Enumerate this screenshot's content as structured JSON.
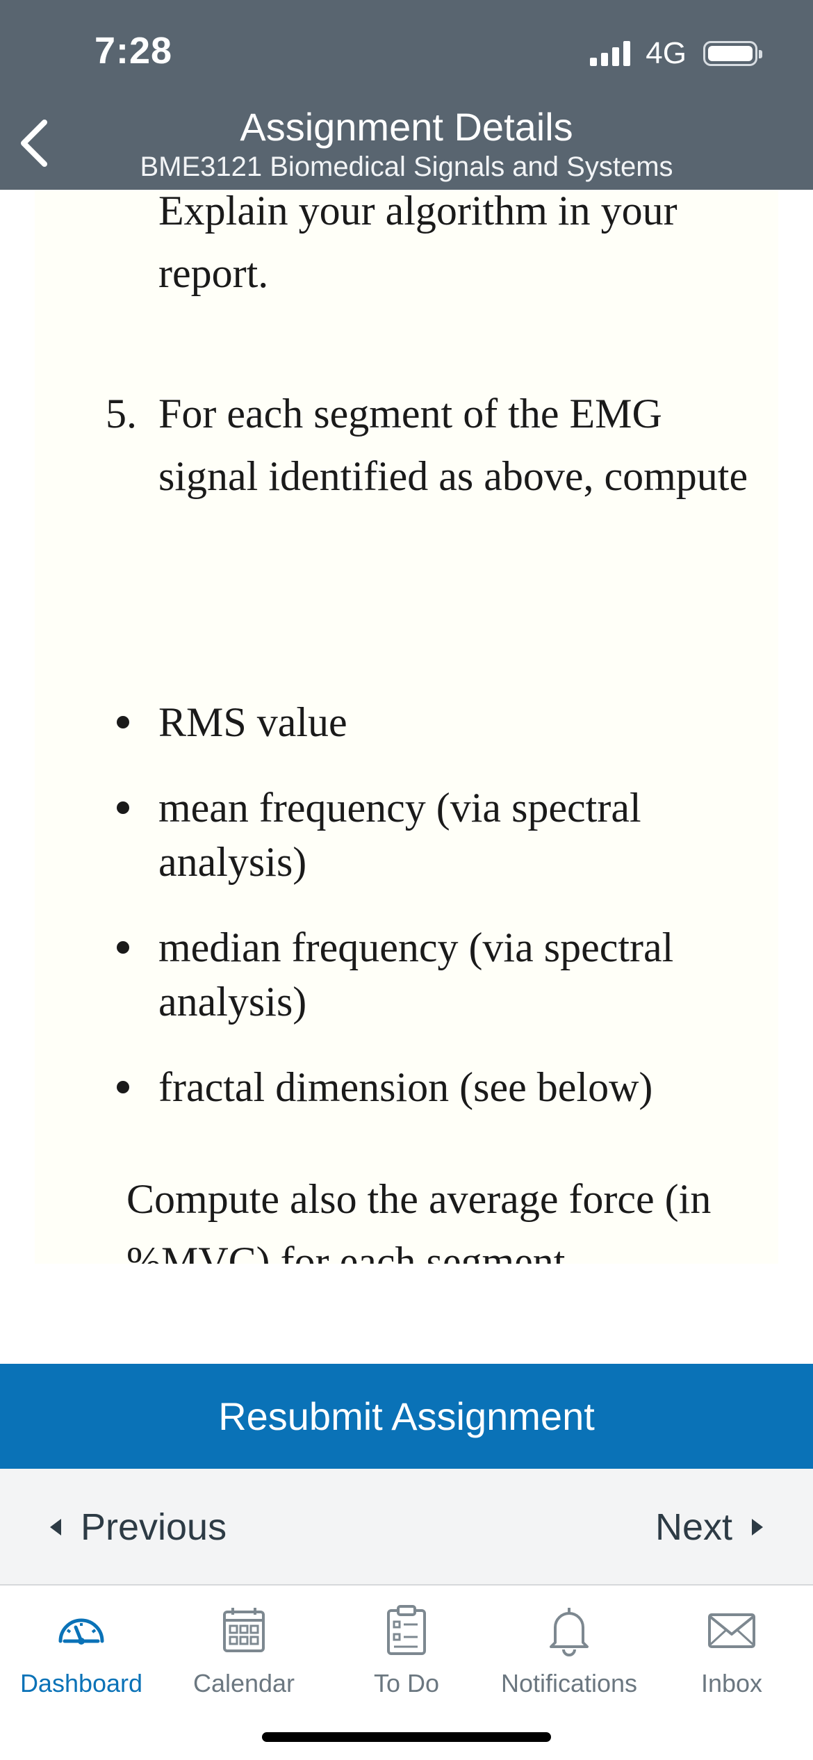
{
  "status_bar": {
    "time": "7:28",
    "network": "4G"
  },
  "nav": {
    "title": "Assignment Details",
    "subtitle": "BME3121 Biomedical Signals and Systems",
    "back_icon": "chevron-left-icon"
  },
  "content": {
    "paragraph_top": "Explain your algorithm in your report.",
    "item5": {
      "number": "5.",
      "text": "For each segment of the EMG signal identified as above, compute"
    },
    "bullets": [
      "RMS value",
      "mean frequency (via spectral analysis)",
      "median frequency (via spectral analysis)",
      "fractal dimension (see below)"
    ],
    "paragraph_bottom": "Compute also the average force (in %MVC) for each segment."
  },
  "actions": {
    "resubmit": "Resubmit Assignment",
    "previous": "Previous",
    "next": "Next"
  },
  "tabbar": {
    "items": [
      {
        "label": "Dashboard",
        "icon": "dashboard-gauge-icon",
        "active": true
      },
      {
        "label": "Calendar",
        "icon": "calendar-icon",
        "active": false
      },
      {
        "label": "To Do",
        "icon": "todo-clipboard-icon",
        "active": false
      },
      {
        "label": "Notifications",
        "icon": "bell-icon",
        "active": false
      },
      {
        "label": "Inbox",
        "icon": "envelope-icon",
        "active": false
      }
    ]
  },
  "colors": {
    "header_bg": "#596570",
    "brand_blue": "#0a72b7",
    "content_bg": "#fffff8",
    "tab_inactive": "#6b7780"
  }
}
